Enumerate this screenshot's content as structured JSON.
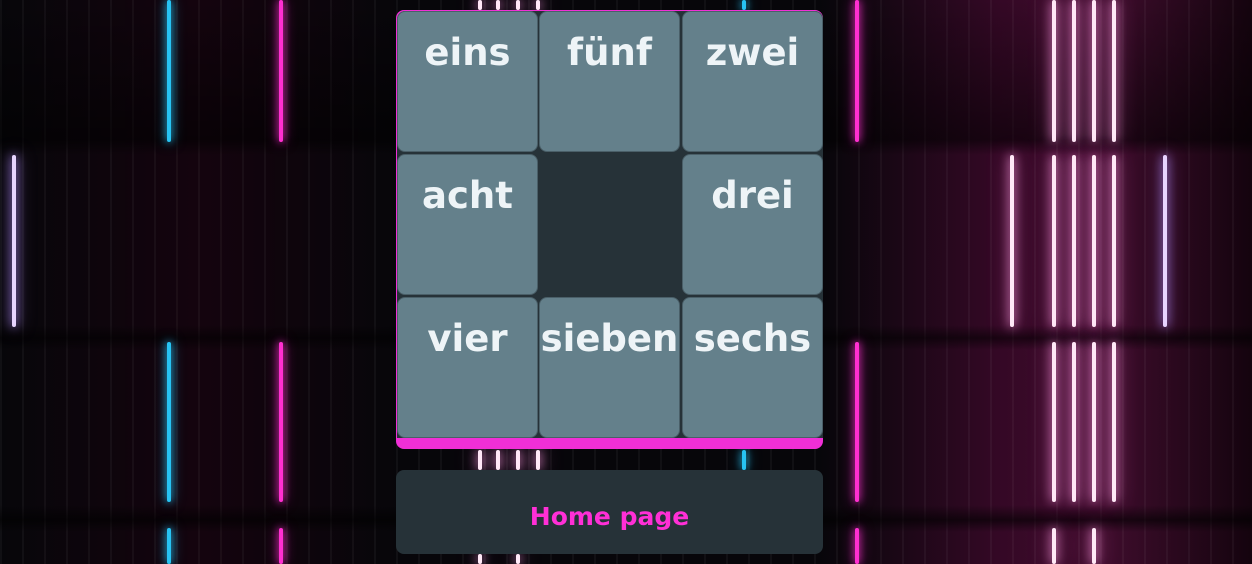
{
  "puzzle": {
    "accent_color": "#f02fd6",
    "tile_color": "#64808b",
    "empty_color": "#263238",
    "tiles": [
      {
        "label": "eins",
        "row": 0,
        "col": 0
      },
      {
        "label": "fünf",
        "row": 0,
        "col": 1
      },
      {
        "label": "zwei",
        "row": 0,
        "col": 2
      },
      {
        "label": "acht",
        "row": 1,
        "col": 0
      },
      {
        "label": "drei",
        "row": 1,
        "col": 2
      },
      {
        "label": "vier",
        "row": 2,
        "col": 0
      },
      {
        "label": "sieben",
        "row": 2,
        "col": 1
      },
      {
        "label": "sechs",
        "row": 2,
        "col": 2
      }
    ],
    "empty_cell": {
      "row": 1,
      "col": 1
    }
  },
  "home_button": {
    "label": "Home page"
  }
}
